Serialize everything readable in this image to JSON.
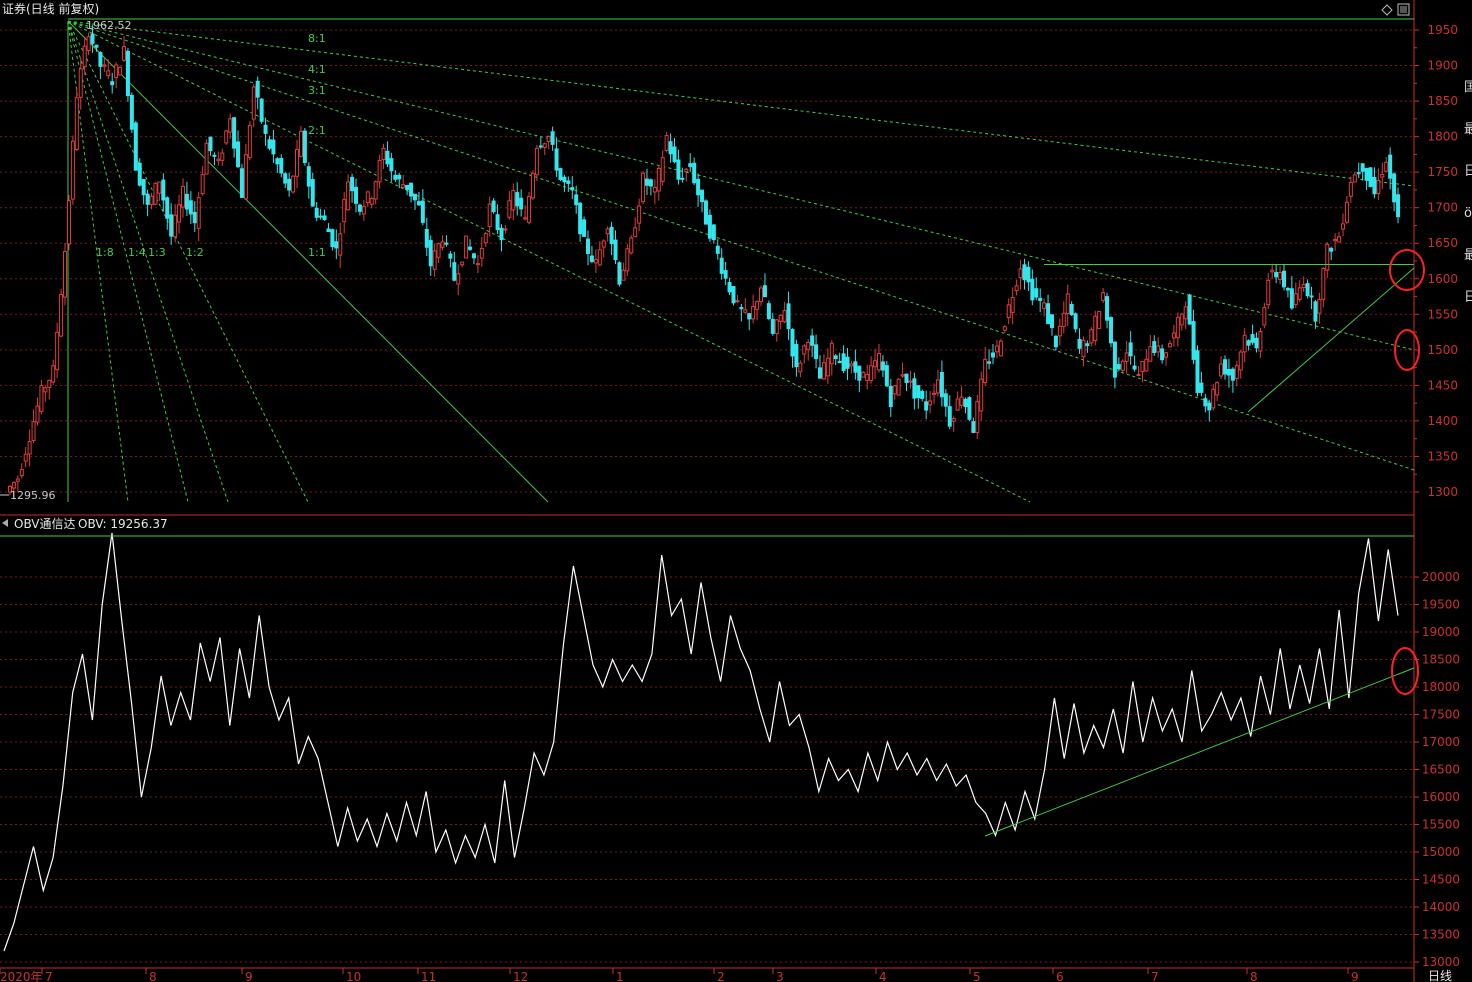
{
  "header": {
    "price_title": "证券(日线 前复权)",
    "obv_title": "OBV通信达",
    "obv_value": "OBV: 19256.37"
  },
  "markers": {
    "high_label": "1962.52",
    "low_label": "1295.96"
  },
  "timeframe_label": "日线",
  "side_glyphs": [
    "",
    "国",
    "",
    "最",
    "",
    "日",
    "",
    "ö",
    "",
    "最",
    "",
    "日"
  ],
  "colors": {
    "background": "#000000",
    "up": "#e03c3c",
    "down": "#33e6ee",
    "gann": "#44cc44",
    "axis": "#cc3030",
    "obv": "#ffffff",
    "highlight_circle": "#ff2020"
  },
  "chart_data": [
    {
      "type": "candlestick",
      "title": "证券(日线 前复权)",
      "x_tick_labels": [
        "2020年",
        "7",
        "8",
        "9",
        "10",
        "11",
        "12",
        "1",
        "2",
        "3",
        "4",
        "5",
        "6",
        "7",
        "8",
        "9"
      ],
      "y_ticks": [
        1300,
        1350,
        1400,
        1450,
        1500,
        1550,
        1600,
        1650,
        1700,
        1750,
        1800,
        1850,
        1900,
        1950
      ],
      "ylim": [
        1280,
        1975
      ],
      "grid": true,
      "price_path": [
        1300,
        1320,
        1380,
        1440,
        1470,
        1640,
        1860,
        1950,
        1900,
        1880,
        1920,
        1760,
        1700,
        1740,
        1660,
        1720,
        1680,
        1790,
        1760,
        1830,
        1720,
        1870,
        1800,
        1760,
        1720,
        1800,
        1700,
        1680,
        1640,
        1740,
        1700,
        1720,
        1780,
        1740,
        1730,
        1700,
        1620,
        1660,
        1600,
        1650,
        1620,
        1700,
        1660,
        1720,
        1680,
        1790,
        1800,
        1740,
        1720,
        1650,
        1620,
        1680,
        1600,
        1650,
        1740,
        1720,
        1800,
        1740,
        1760,
        1700,
        1650,
        1600,
        1560,
        1540,
        1590,
        1520,
        1560,
        1470,
        1520,
        1460,
        1500,
        1480,
        1470,
        1460,
        1490,
        1430,
        1470,
        1440,
        1420,
        1460,
        1400,
        1440,
        1390,
        1480,
        1500,
        1560,
        1620,
        1580,
        1560,
        1510,
        1570,
        1500,
        1520,
        1580,
        1470,
        1500,
        1460,
        1510,
        1490,
        1520,
        1570,
        1450,
        1420,
        1480,
        1460,
        1520,
        1500,
        1600,
        1610,
        1560,
        1600,
        1550,
        1640,
        1660,
        1740,
        1760,
        1720,
        1770,
        1680
      ],
      "gann_fan": {
        "origin_value": 1962.52,
        "angles": [
          "8:1",
          "4:1",
          "3:1",
          "2:1",
          "1:1",
          "1:2",
          "1:3",
          "1:4",
          "1:8"
        ]
      },
      "annotations": [
        {
          "text": "1962.52",
          "kind": "high"
        },
        {
          "text": "1295.96",
          "kind": "low"
        }
      ],
      "horizontal_line": 1620
    },
    {
      "type": "line",
      "title": "OBV通信达",
      "series": [
        {
          "name": "OBV",
          "last": 19256.37
        }
      ],
      "y_ticks": [
        13000,
        13500,
        14000,
        14500,
        15000,
        15500,
        16000,
        16500,
        17000,
        17500,
        18000,
        18500,
        19000,
        19500,
        20000
      ],
      "ylim": [
        12850,
        20800
      ],
      "values": [
        13200,
        13700,
        14400,
        15100,
        14300,
        14900,
        16200,
        17900,
        18600,
        17400,
        19500,
        20800,
        19200,
        17700,
        16000,
        16900,
        18200,
        17300,
        17900,
        17400,
        18800,
        18100,
        18900,
        17300,
        18700,
        17800,
        19300,
        18000,
        17400,
        17800,
        16600,
        17100,
        16700,
        15900,
        15100,
        15800,
        15200,
        15600,
        15100,
        15700,
        15200,
        15900,
        15300,
        16100,
        15000,
        15400,
        14800,
        15300,
        14900,
        15500,
        14800,
        16300,
        14900,
        15800,
        16800,
        16400,
        17000,
        18800,
        20200,
        19300,
        18400,
        18000,
        18500,
        18100,
        18400,
        18100,
        18600,
        20400,
        19300,
        19600,
        18600,
        19900,
        18900,
        18100,
        19300,
        18700,
        18300,
        17600,
        17000,
        18100,
        17300,
        17500,
        16900,
        16100,
        16700,
        16300,
        16500,
        16100,
        16800,
        16300,
        17000,
        16500,
        16800,
        16400,
        16700,
        16300,
        16600,
        16200,
        16400,
        15900,
        15700,
        15300,
        15900,
        15400,
        16100,
        15600,
        16500,
        17800,
        16700,
        17700,
        16800,
        17300,
        16900,
        17600,
        16800,
        18100,
        17000,
        17800,
        17200,
        17600,
        17000,
        18300,
        17200,
        17500,
        17900,
        17400,
        17800,
        17100,
        18200,
        17500,
        18700,
        17600,
        18400,
        17700,
        18700,
        17600,
        19400,
        17800,
        19700,
        20700,
        19200,
        20500,
        19300
      ]
    }
  ]
}
